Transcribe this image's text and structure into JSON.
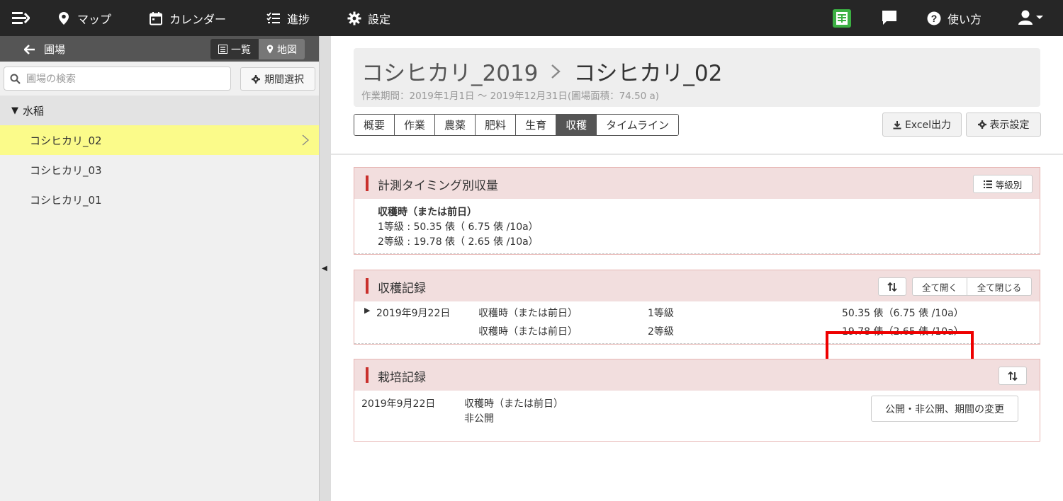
{
  "nav": {
    "items": [
      {
        "icon": "map-pin-icon",
        "label": "マップ"
      },
      {
        "icon": "calendar-icon",
        "label": "カレンダー"
      },
      {
        "icon": "progress-list-icon",
        "label": "進捗"
      },
      {
        "icon": "gear-icon",
        "label": "設定"
      }
    ],
    "help_label": "使い方"
  },
  "sidebar": {
    "back_label": "圃場",
    "view_list_label": "一覧",
    "view_map_label": "地図",
    "search_placeholder": "圃場の検索",
    "period_button": "期間選択",
    "group_label": "水稲",
    "fields": [
      "コシヒカリ_02",
      "コシヒカリ_03",
      "コシヒカリ_01"
    ],
    "selected_index": 0
  },
  "header": {
    "crumb1": "コシヒカリ_2019",
    "crumb2": "コシヒカリ_02",
    "subtitle": "作業期間：2019年1月1日 〜 2019年12月31日(圃場面積：74.50 a)"
  },
  "tabs": [
    "概要",
    "作業",
    "農薬",
    "肥料",
    "生育",
    "収穫",
    "タイムライン"
  ],
  "active_tab": "収穫",
  "toolbar": {
    "excel_label": "Excel出力",
    "display_settings_label": "表示設定"
  },
  "timing_panel": {
    "title": "計測タイミング別収量",
    "grade_button": "等級別",
    "timing_label": "収穫時（または前日）",
    "lines": [
      "1等級 : 50.35 俵（ 6.75 俵 /10a）",
      "2等級 : 19.78 俵（ 2.65 俵 /10a）"
    ]
  },
  "harvest_panel": {
    "title": "収穫記録",
    "expand_all": "全て開く",
    "collapse_all": "全て閉じる",
    "date": "2019年9月22日",
    "rows": [
      {
        "timing": "収穫時（または前日）",
        "grade": "1等級",
        "amount": "50.35 俵（6.75 俵 /10a）"
      },
      {
        "timing": "収穫時（または前日）",
        "grade": "2等級",
        "amount": "19.78 俵（2.65 俵 /10a）"
      }
    ]
  },
  "cultivation_panel": {
    "title": "栽培記録",
    "date": "2019年9月22日",
    "timing": "収穫時（または前日）",
    "visibility": "非公開",
    "change_button": "公開・非公開、期間の変更"
  },
  "colors": {
    "topbar": "#262626",
    "accent_red": "#c9302c",
    "panel_head": "#f2dede",
    "selected_row": "#fbfb8a"
  }
}
